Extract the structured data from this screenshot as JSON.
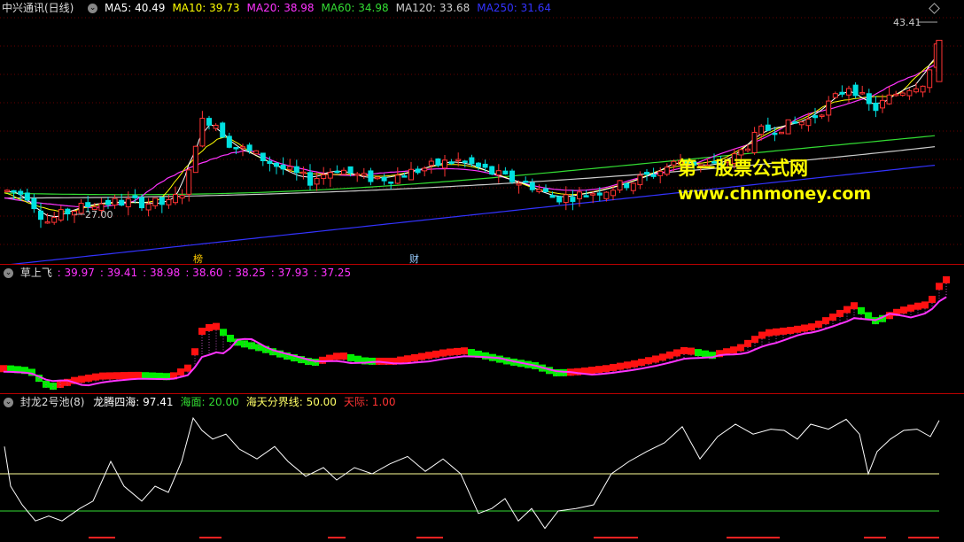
{
  "main": {
    "title": "中兴通讯(日线)",
    "ma": [
      {
        "label": "MA5: 40.49",
        "color": "#ffffff"
      },
      {
        "label": "MA10: 39.73",
        "color": "#ffff00"
      },
      {
        "label": "MA20: 38.98",
        "color": "#ff33ff"
      },
      {
        "label": "MA60: 34.98",
        "color": "#33dd33"
      },
      {
        "label": "MA120: 33.68",
        "color": "#cccccc"
      },
      {
        "label": "MA250: 31.64",
        "color": "#3333ff"
      }
    ],
    "high_label": "43.41",
    "low_label": "27.00",
    "mark_bang": "榜",
    "mark_cai": "财",
    "watermark_cn": "第一股票公式网",
    "watermark_url": "www.chnmoney.com"
  },
  "sub1": {
    "title": "草上飞",
    "values": [
      ": 39.97",
      ": 39.41",
      ": 38.98",
      ": 38.60",
      ": 38.25",
      ": 37.93",
      ": 37.25"
    ]
  },
  "sub2": {
    "title": "封龙2号池(8)",
    "items": [
      {
        "label": "龙腾四海: 97.41",
        "color": "#ffffff"
      },
      {
        "label": "海面: 20.00",
        "color": "#33dd33"
      },
      {
        "label": "海天分界线: 50.00",
        "color": "#ffff66"
      },
      {
        "label": "天际: 1.00",
        "color": "#ff3333"
      }
    ]
  },
  "colors": {
    "up": "#ff3333",
    "down": "#00e0e0",
    "green": "#00ff00",
    "magenta": "#ff33ff"
  }
}
